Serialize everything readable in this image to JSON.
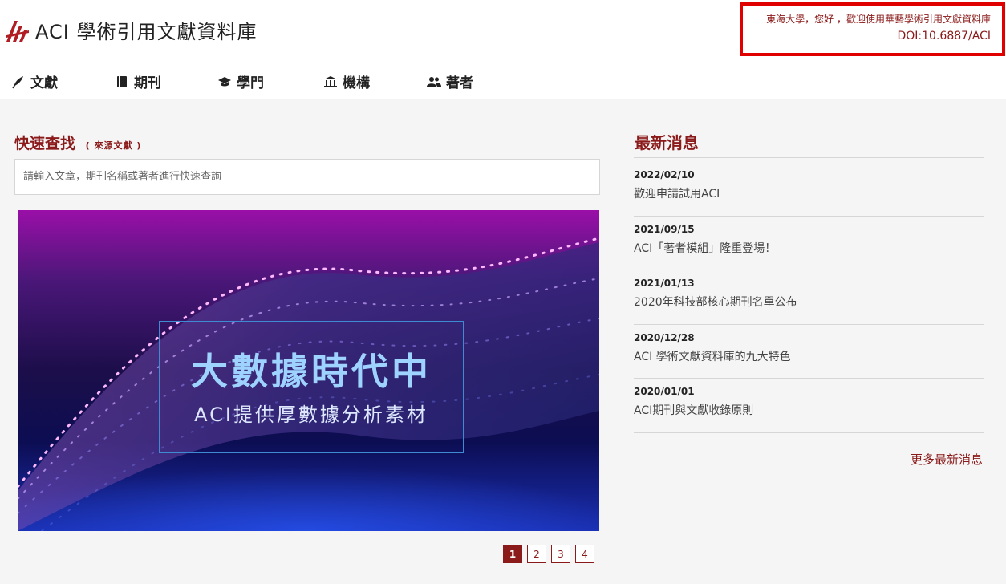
{
  "header": {
    "logo_text": "ACI 學術引用文獻資料庫",
    "greeting": "東海大學，您好 ，歡迎使用華藝學術引用文獻資料庫",
    "doi": "DOI:10.6887/ACI"
  },
  "nav": {
    "items": [
      {
        "label": "文獻",
        "icon": "pen-icon"
      },
      {
        "label": "期刊",
        "icon": "book-icon"
      },
      {
        "label": "學門",
        "icon": "graduation-cap-icon"
      },
      {
        "label": "機構",
        "icon": "institution-icon"
      },
      {
        "label": "著者",
        "icon": "users-icon"
      }
    ]
  },
  "quick_search": {
    "title": "快速查找",
    "subtitle": "( 來源文獻 )",
    "placeholder": "請輸入文章，期刊名稱或著者進行快速查詢"
  },
  "banner": {
    "headline": "大數據時代中",
    "subheadline": "ACI提供厚數據分析素材"
  },
  "pagination": {
    "pages": [
      "1",
      "2",
      "3",
      "4"
    ],
    "current": "1"
  },
  "news": {
    "title": "最新消息",
    "items": [
      {
        "date": "2022/02/10",
        "text": "歡迎申請試用ACI"
      },
      {
        "date": "2021/09/15",
        "text": "ACI「著者模組」隆重登場！"
      },
      {
        "date": "2021/01/13",
        "text": "2020年科技部核心期刊名單公布"
      },
      {
        "date": "2020/12/28",
        "text": "ACI 學術文獻資料庫的九大特色"
      },
      {
        "date": "2020/01/01",
        "text": "ACI期刊與文獻收錄原則"
      }
    ],
    "more_label": "更多最新消息"
  },
  "colors": {
    "brand": "#8b1a1a",
    "highlight_border": "#e00000"
  }
}
